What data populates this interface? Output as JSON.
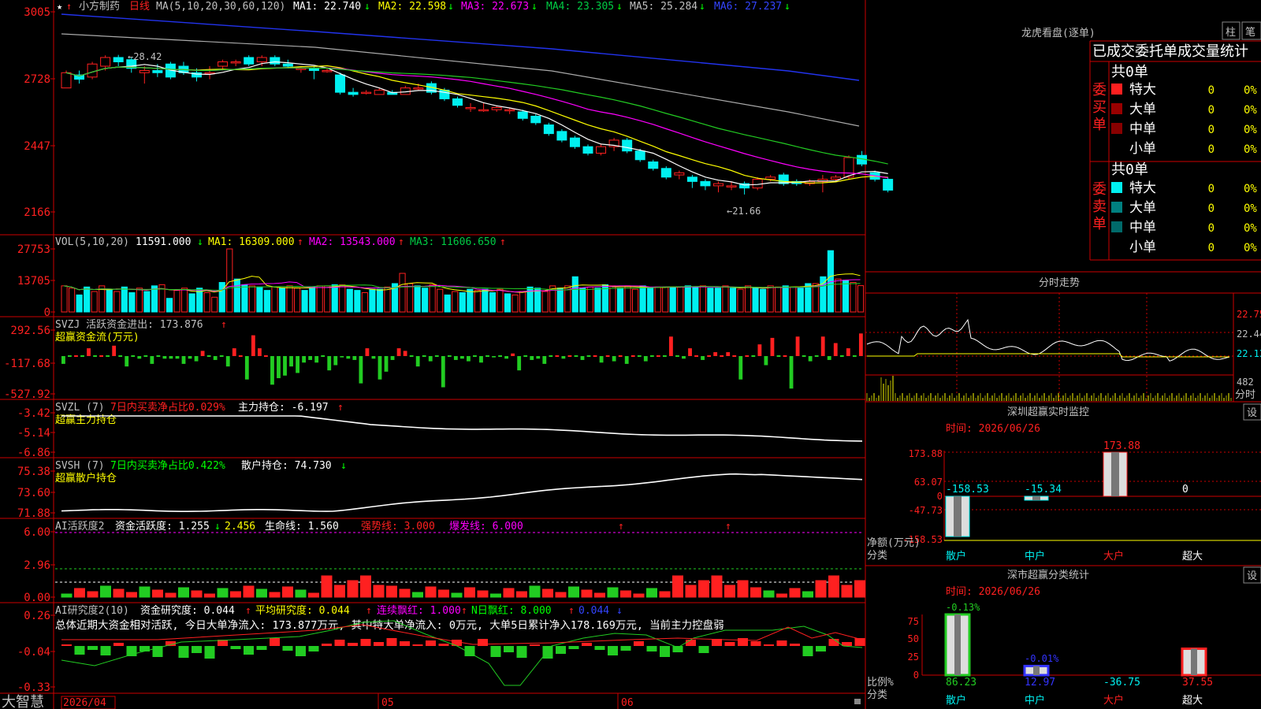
{
  "app": {
    "name": "大智慧"
  },
  "colors": {
    "red": "#ff2020",
    "green": "#22cc22",
    "cyan": "#00f0f0",
    "white": "#ffffff",
    "yellow": "#ffff00",
    "magenta": "#ff00ff",
    "blue": "#2233ee",
    "gray": "#aaaaaa",
    "grid": "#cc0000",
    "text": "#c0c0c0"
  },
  "header": {
    "star": "★",
    "stock": "小方制药",
    "period": "日线",
    "ma_label": "MA(5,10,20,30,60,120)",
    "ma1": "MA1: 22.740",
    "ma2": "MA2: 22.598",
    "ma3": "MA3: 22.673",
    "ma4": "MA4: 23.305",
    "ma5": "MA5: 25.284",
    "ma6": "MA6: 27.237",
    "arrow_down": "↓",
    "arrow_up": "↑"
  },
  "price_axis": [
    "3005",
    "2728",
    "2447",
    "2166"
  ],
  "price_annotations": {
    "high": "28.42",
    "low": "21.66"
  },
  "vol": {
    "axis": [
      "27753",
      "13705",
      "0"
    ],
    "title": "VOL(5,10,20)",
    "value": "11591.000",
    "ma1": "MA1: 16309.000",
    "ma2": "MA2: 13543.000",
    "ma3": "MA3: 11606.650"
  },
  "svzj": {
    "axis": [
      "292.56",
      "-117.68",
      "-527.92"
    ],
    "title": "SVZJ  活跃资金进出: 173.876",
    "sub": "超赢资金流(万元)"
  },
  "svzl": {
    "axis": [
      "-3.42",
      "-5.14",
      "-6.86"
    ],
    "name": "SVZL (7)",
    "ratio": "7日内买卖净占比0.029%",
    "pos": "主力持仓: -6.197",
    "sub": "超赢主力持仓"
  },
  "svsh": {
    "axis": [
      "75.38",
      "73.60",
      "71.88"
    ],
    "name": "SVSH (7)",
    "ratio": "7日内买卖净占比0.422%",
    "pos": "散户持仓: 74.730",
    "sub": "超赢散户持仓"
  },
  "ai1": {
    "axis": [
      "6.00",
      "2.96",
      "0.00"
    ],
    "name": "AI活跃度2",
    "v1": "资金活跃度: 1.255",
    "v2": "2.456",
    "v3": "生命线: 1.560",
    "v4": "强势线: 3.000",
    "v5": "爆发线: 6.000"
  },
  "ai2": {
    "axis": [
      "0.26",
      "-0.04",
      "-0.33"
    ],
    "name": "AI研究度2(10)",
    "v1": "资金研究度: 0.044",
    "v2": "平均研究度: 0.044",
    "v3": "连续飘红: 1.000",
    "v4": "N日飘红: 8.000",
    "v5": "0.044",
    "summary": "总体近期大资金相对活跃, 今日大单净流入: 173.877万元, 其中特大单净流入: 0万元, 大单5日累计净入178.169万元, 当前主力控盘弱"
  },
  "x_axis": [
    "2026/04",
    "05",
    "06"
  ],
  "right": {
    "lhb_title": "龙虎看盘(逐单)",
    "btn_zhu": "柱",
    "btn_bi": "笔",
    "stats_title": "已成交委托单成交量统计",
    "buy_label": "委买单",
    "sell_label": "委卖单",
    "buy_total": "共0单",
    "sell_total": "共0单",
    "rows": [
      {
        "name": "特大",
        "v": "0",
        "p": "0%"
      },
      {
        "name": "大单",
        "v": "0",
        "p": "0%"
      },
      {
        "name": "中单",
        "v": "0",
        "p": "0%"
      },
      {
        "name": "小单",
        "v": "0",
        "p": "0%"
      }
    ],
    "fs_title": "分时走势",
    "fs_axis": [
      "22.75",
      "22.44",
      "22.13",
      "482",
      "分时"
    ],
    "sz_title": "深圳超赢实时监控",
    "btn_set": "设",
    "sz_time": "时间: 2026/06/26",
    "sz_axis": [
      "173.88",
      "63.07",
      "0",
      "-47.73",
      "-158.53"
    ],
    "sz_ylabel": "净额(万元)",
    "sz_xlabel": "分类",
    "sz_values": [
      {
        "cat": "散户",
        "val": -158.53,
        "label": "-158.53"
      },
      {
        "cat": "中户",
        "val": -15.34,
        "label": "-15.34"
      },
      {
        "cat": "大户",
        "val": 173.88,
        "label": "173.88"
      },
      {
        "cat": "超大",
        "val": 0,
        "label": "0"
      }
    ],
    "sc_title": "深市超赢分类统计",
    "sc_time": "时间: 2026/06/26",
    "sc_axis": [
      "75",
      "50",
      "25",
      "0"
    ],
    "sc_ylabel": "比例%",
    "sc_xlabel": "分类",
    "sc_values": [
      {
        "cat": "散户",
        "top": "-0.13%",
        "bottom": "86.23",
        "val": 86.23
      },
      {
        "cat": "中户",
        "top": "-0.01%",
        "bottom": "12.97",
        "val": 12.97
      },
      {
        "cat": "大户",
        "top": "",
        "bottom": "-36.75",
        "val": 0
      },
      {
        "cat": "超大",
        "top": "",
        "bottom": "37.55",
        "val": 37.55
      }
    ]
  },
  "chart_data": [
    {
      "type": "candlestick",
      "title": "小方制药 日线",
      "ylim": [
        21.2,
        30.4
      ],
      "candles": [
        [
          26.9,
          27.6,
          27.7,
          26.9
        ],
        [
          27.5,
          27.3,
          27.7,
          27.1
        ],
        [
          27.4,
          28.0,
          28.1,
          27.3
        ],
        [
          27.9,
          28.3,
          28.4,
          27.7
        ],
        [
          28.3,
          28.1,
          28.42,
          27.9
        ],
        [
          28.2,
          27.8,
          28.3,
          27.6
        ],
        [
          27.6,
          27.7,
          27.9,
          27.1
        ],
        [
          27.7,
          27.6,
          28.0,
          27.4
        ],
        [
          28.0,
          27.4,
          28.1,
          27.3
        ],
        [
          27.9,
          27.6,
          28.1,
          27.5
        ],
        [
          27.6,
          27.4,
          27.8,
          27.2
        ],
        [
          27.6,
          27.6,
          27.9,
          27.3
        ],
        [
          27.9,
          28.1,
          28.2,
          27.7
        ],
        [
          28.1,
          28.1,
          28.2,
          27.9
        ],
        [
          28.3,
          28.0,
          28.4,
          27.9
        ],
        [
          28.1,
          28.3,
          28.4,
          27.9
        ],
        [
          28.3,
          28.0,
          28.4,
          27.9
        ],
        [
          28.0,
          27.9,
          28.2,
          27.8
        ],
        [
          27.8,
          27.8,
          27.9,
          27.6
        ],
        [
          27.8,
          27.7,
          27.9,
          27.3
        ],
        [
          27.7,
          27.7,
          27.8,
          27.6
        ],
        [
          27.5,
          26.7,
          27.6,
          26.6
        ],
        [
          26.7,
          26.6,
          26.9,
          26.5
        ],
        [
          26.7,
          26.7,
          26.8,
          26.6
        ],
        [
          26.6,
          26.8,
          26.9,
          26.6
        ],
        [
          26.7,
          26.6,
          26.8,
          26.6
        ],
        [
          26.6,
          26.9,
          27.0,
          26.6
        ],
        [
          26.9,
          26.9,
          27.1,
          26.8
        ],
        [
          27.1,
          26.7,
          27.2,
          26.6
        ],
        [
          26.8,
          26.4,
          26.9,
          26.3
        ],
        [
          26.4,
          26.1,
          26.5,
          26.0
        ],
        [
          26.0,
          26.0,
          26.2,
          25.8
        ],
        [
          25.9,
          25.9,
          26.2,
          25.8
        ],
        [
          25.9,
          26.0,
          26.1,
          25.8
        ],
        [
          25.9,
          25.9,
          26.0,
          25.7
        ],
        [
          25.8,
          25.5,
          25.9,
          25.4
        ],
        [
          25.6,
          25.3,
          25.7,
          25.2
        ],
        [
          25.2,
          24.8,
          25.3,
          24.7
        ],
        [
          24.9,
          24.5,
          25.0,
          24.4
        ],
        [
          24.6,
          24.2,
          24.7,
          24.1
        ],
        [
          24.2,
          23.9,
          24.3,
          23.8
        ],
        [
          23.9,
          24.2,
          24.3,
          23.8
        ],
        [
          24.2,
          24.5,
          24.6,
          24.0
        ],
        [
          24.5,
          24.0,
          24.6,
          23.9
        ],
        [
          24.0,
          23.6,
          24.1,
          23.5
        ],
        [
          23.5,
          23.2,
          23.6,
          23.1
        ],
        [
          23.2,
          22.8,
          23.3,
          22.7
        ],
        [
          22.9,
          23.0,
          23.1,
          22.7
        ],
        [
          22.8,
          22.6,
          22.9,
          22.3
        ],
        [
          22.6,
          22.4,
          22.7,
          22.2
        ],
        [
          22.4,
          22.5,
          22.6,
          22.1
        ],
        [
          22.4,
          22.4,
          22.6,
          22.2
        ],
        [
          22.5,
          22.3,
          22.6,
          22.0
        ],
        [
          22.3,
          22.7,
          22.8,
          22.2
        ],
        [
          22.7,
          22.8,
          22.9,
          22.6
        ],
        [
          22.9,
          22.5,
          23.0,
          22.4
        ],
        [
          22.6,
          22.5,
          22.7,
          22.4
        ],
        [
          22.5,
          22.6,
          22.7,
          22.4
        ],
        [
          22.6,
          22.7,
          22.9,
          22.1
        ],
        [
          22.7,
          22.8,
          22.9,
          22.6
        ],
        [
          22.8,
          23.7,
          23.8,
          22.7
        ],
        [
          23.8,
          23.4,
          24.0,
          23.3
        ],
        [
          23.0,
          22.7,
          23.1,
          22.6
        ],
        [
          22.7,
          22.2,
          22.8,
          22.1
        ]
      ]
    },
    {
      "type": "bar",
      "title": "VOL",
      "ylim": [
        0,
        27753
      ],
      "values": [
        11500,
        10500,
        7500,
        11000,
        9000,
        11500,
        10000,
        9000,
        11000,
        8500,
        10500,
        9000,
        11500,
        12000,
        6000,
        9500,
        10500,
        8000,
        10500,
        8500,
        6500,
        13000,
        27753,
        14500,
        12000,
        11500,
        11000,
        9500,
        11000,
        10500,
        11500,
        10500,
        9500,
        11000,
        11500,
        11500,
        12000,
        12000,
        10000,
        9500,
        8500,
        10000,
        10000,
        11000,
        12500,
        17000,
        12500,
        11500,
        10500,
        12000,
        10000,
        7500,
        9000,
        8500,
        10000,
        9500,
        10000,
        8500,
        10000,
        8000,
        7500,
        9000,
        11000,
        10500,
        9000,
        11500,
        10500,
        11500,
        15500,
        10500,
        11000,
        10500,
        12000,
        11500,
        10500,
        11500,
        10000,
        11500,
        10500,
        11000,
        11000,
        11000,
        11000,
        11500,
        11000,
        11500,
        10500,
        10500,
        11500,
        10500,
        10000,
        11500,
        10500,
        10000,
        11500,
        11000,
        11500,
        11000,
        10500,
        12500,
        12500,
        15500,
        27000,
        14500,
        14000,
        13000,
        11591
      ]
    },
    {
      "type": "bar",
      "title": "SVZJ",
      "values": [
        -60,
        0,
        0,
        0,
        60,
        0,
        0,
        0,
        80,
        0,
        -80,
        0,
        -20,
        0,
        -60,
        0,
        -20,
        -20,
        -20,
        -60,
        -20,
        -40,
        40,
        0,
        -30,
        0,
        -80,
        60,
        0,
        -180,
        160,
        60,
        0,
        -220,
        -170,
        -150,
        -80,
        -130,
        -50,
        -30,
        -50,
        0,
        -110,
        -70,
        -10,
        -20,
        -30,
        -210,
        60,
        -20,
        -180,
        -120,
        -30,
        60,
        40,
        0,
        -80,
        0,
        -40,
        0,
        -240,
        0,
        -30,
        -20,
        -40,
        0,
        -50,
        0,
        -10,
        0,
        -20,
        20,
        -110,
        0,
        -30,
        -20,
        -60,
        0,
        0,
        -20,
        0,
        0,
        -30,
        0,
        0,
        -50,
        0,
        -40,
        0,
        -60,
        0,
        0,
        -40,
        0,
        0,
        0,
        150,
        0,
        -20,
        60,
        0,
        -30,
        0,
        30,
        0,
        30,
        0,
        -180,
        0,
        0,
        90,
        -70,
        140,
        0,
        0,
        -250,
        150,
        0,
        -40,
        0,
        150,
        -30,
        100,
        0,
        60,
        0,
        174
      ]
    }
  ]
}
